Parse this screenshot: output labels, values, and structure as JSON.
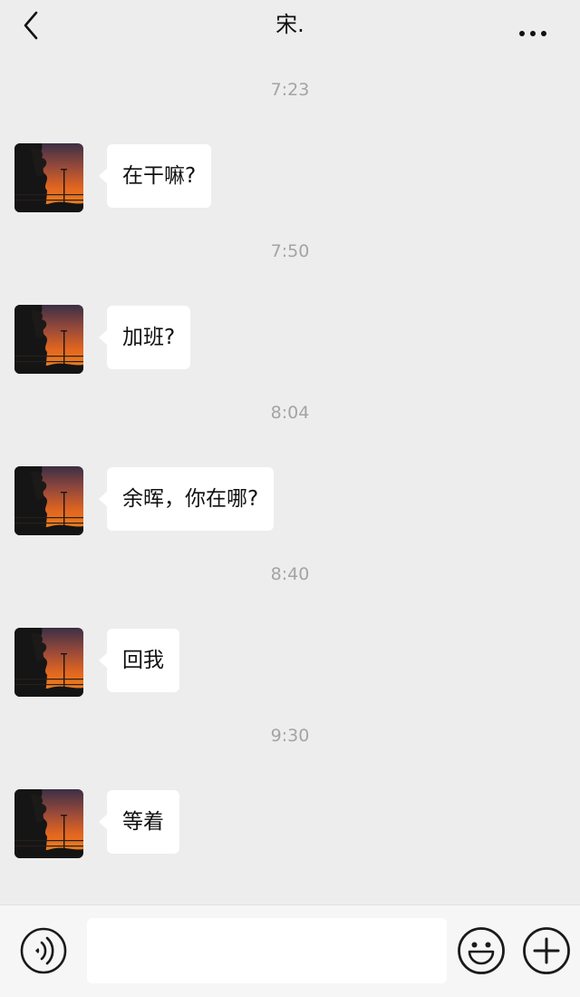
{
  "header": {
    "title": "宋.",
    "back_icon": "chevron-left-icon",
    "more_icon": "more-dots-icon"
  },
  "messages": [
    {
      "time": "7:23",
      "text": "在干嘛?"
    },
    {
      "time": "7:50",
      "text": "加班?"
    },
    {
      "time": "8:04",
      "text": "余晖，你在哪?"
    },
    {
      "time": "8:40",
      "text": "回我"
    },
    {
      "time": "9:30",
      "text": "等着"
    }
  ],
  "input_bar": {
    "text_value": "",
    "voice_icon": "voice-icon",
    "emoji_icon": "emoji-icon",
    "plus_icon": "plus-icon"
  }
}
